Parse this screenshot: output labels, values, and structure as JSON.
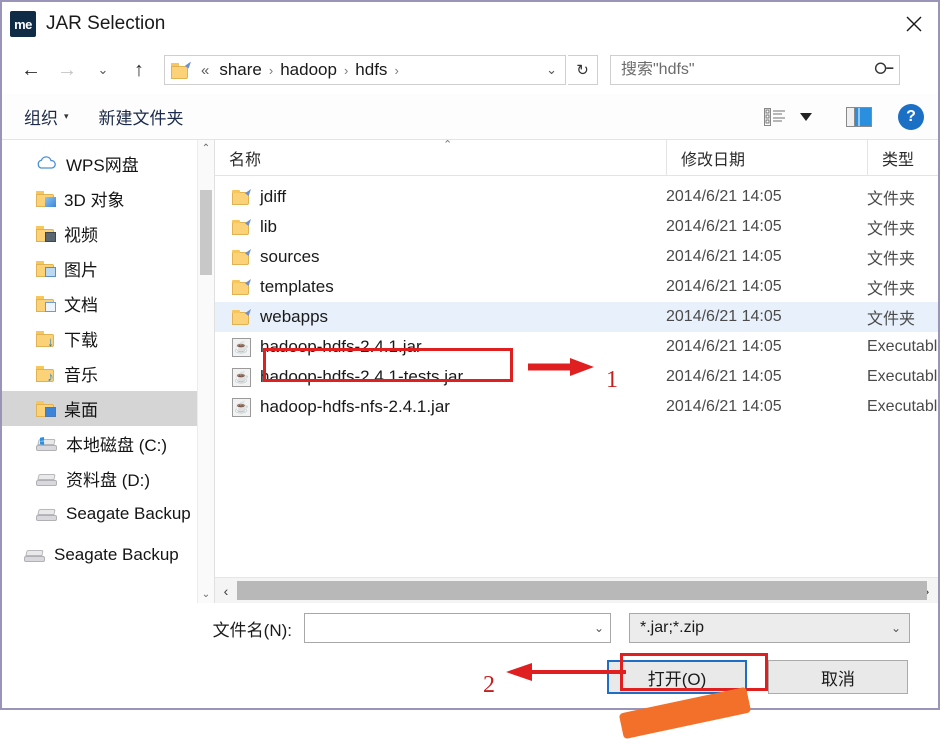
{
  "window": {
    "title": "JAR Selection",
    "app_icon_text": "me",
    "close_icon": "close-icon"
  },
  "nav": {
    "back_icon": "←",
    "forward_icon": "→",
    "recent_icon": "⌄",
    "up_icon": "↑",
    "refresh_icon": "↻",
    "breadcrumb": {
      "overflow": "«",
      "separator": "›",
      "items": [
        "share",
        "hadoop",
        "hdfs"
      ],
      "trailing_separator": "›",
      "dropdown_icon": "⌄"
    }
  },
  "search": {
    "placeholder": "搜索\"hdfs\"",
    "value": "",
    "icon": "search-icon"
  },
  "toolbar": {
    "organize_label": "组织",
    "organize_caret": "▾",
    "new_folder_label": "新建文件夹",
    "view_icon": "view-options-icon",
    "view_caret": "▾",
    "preview_icon": "preview-pane-icon",
    "help_label": "?"
  },
  "sidebar": {
    "items": [
      {
        "label": "WPS网盘",
        "icon": "cloud-icon",
        "selected": false
      },
      {
        "label": "3D 对象",
        "icon": "folder-3d-icon",
        "selected": false
      },
      {
        "label": "视频",
        "icon": "folder-video-icon",
        "selected": false
      },
      {
        "label": "图片",
        "icon": "folder-pictures-icon",
        "selected": false
      },
      {
        "label": "文档",
        "icon": "folder-documents-icon",
        "selected": false
      },
      {
        "label": "下载",
        "icon": "folder-downloads-icon",
        "selected": false
      },
      {
        "label": "音乐",
        "icon": "folder-music-icon",
        "selected": false
      },
      {
        "label": "桌面",
        "icon": "folder-desktop-icon",
        "selected": true
      },
      {
        "label": "本地磁盘 (C:)",
        "icon": "drive-windows-icon",
        "selected": false
      },
      {
        "label": "资料盘 (D:)",
        "icon": "drive-icon",
        "selected": false
      },
      {
        "label": "Seagate Backup",
        "icon": "drive-icon",
        "selected": false
      },
      {
        "label": "Seagate Backup",
        "icon": "drive-icon",
        "selected": false
      }
    ],
    "scroll_up_icon": "⌃",
    "scroll_down_icon": "⌄"
  },
  "filelist": {
    "columns": {
      "name": "名称",
      "date": "修改日期",
      "type": "类型"
    },
    "sort_indicator": "⌃",
    "rows": [
      {
        "name": "jdiff",
        "date": "2014/6/21 14:05",
        "type": "文件夹",
        "icon": "folder-icon",
        "kind": "folder",
        "hover": false
      },
      {
        "name": "lib",
        "date": "2014/6/21 14:05",
        "type": "文件夹",
        "icon": "folder-icon",
        "kind": "folder",
        "hover": false
      },
      {
        "name": "sources",
        "date": "2014/6/21 14:05",
        "type": "文件夹",
        "icon": "folder-icon",
        "kind": "folder",
        "hover": false
      },
      {
        "name": "templates",
        "date": "2014/6/21 14:05",
        "type": "文件夹",
        "icon": "folder-icon",
        "kind": "folder",
        "hover": false
      },
      {
        "name": "webapps",
        "date": "2014/6/21 14:05",
        "type": "文件夹",
        "icon": "folder-icon",
        "kind": "folder",
        "hover": true
      },
      {
        "name": "hadoop-hdfs-2.4.1.jar",
        "date": "2014/6/21 14:05",
        "type": "Executable Jar File",
        "icon": "jar-file-icon",
        "kind": "jar",
        "hover": false
      },
      {
        "name": "hadoop-hdfs-2.4.1-tests.jar",
        "date": "2014/6/21 14:05",
        "type": "Executable Jar File",
        "icon": "jar-file-icon",
        "kind": "jar",
        "hover": false
      },
      {
        "name": "hadoop-hdfs-nfs-2.4.1.jar",
        "date": "2014/6/21 14:05",
        "type": "Executable Jar File",
        "icon": "jar-file-icon",
        "kind": "jar",
        "hover": false
      }
    ],
    "hscroll": {
      "left_icon": "‹",
      "right_icon": "›"
    }
  },
  "footer": {
    "filename_label": "文件名(N):",
    "filename_value": "",
    "filename_chevron": "⌄",
    "filter_value": "*.jar;*.zip",
    "filter_chevron": "⌄",
    "open_button": "打开(O)",
    "cancel_button": "取消"
  },
  "annotations": {
    "marker_1": "1",
    "marker_2": "2",
    "accent_red": "#e02020",
    "accent_blue": "#1d6ec4",
    "accent_orange": "#f2702a"
  }
}
